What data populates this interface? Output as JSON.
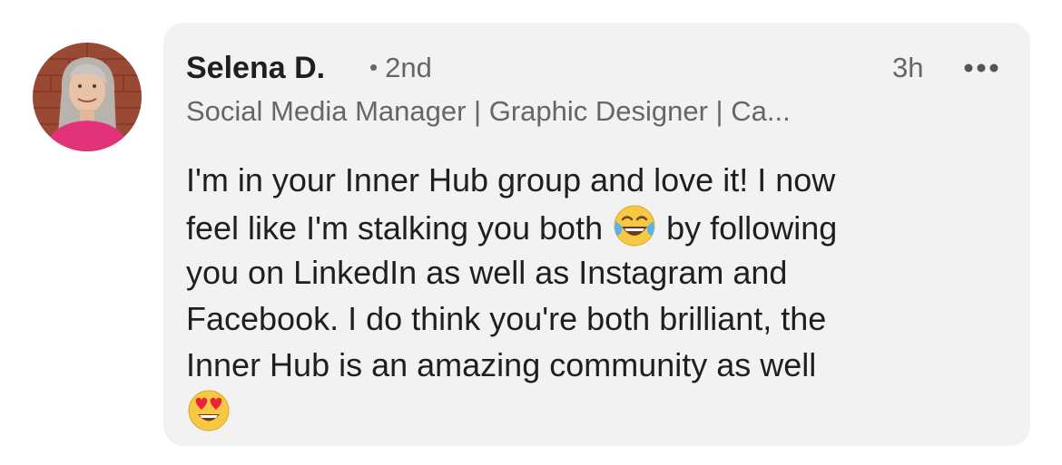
{
  "comment": {
    "author": {
      "name": "Selena D.",
      "degree": "2nd",
      "headline": "Social Media Manager | Graphic Designer | Ca..."
    },
    "time": "3h",
    "more_icon": "more-horizontal-icon",
    "message": {
      "line1": "I'm in your Inner Hub group and love it! I now",
      "line2_before": "feel like I'm stalking you both",
      "line2_emoji": "joy-emoji",
      "line2_after": "by following",
      "line3": "you on LinkedIn as well as Instagram and",
      "line4": "Facebook. I do think you're both brilliant, the",
      "line5": "Inner Hub is an amazing community as well",
      "line6_emoji": "heart-eyes-emoji"
    }
  },
  "colors": {
    "bubble_bg": "#f2f2f2",
    "text_primary": "#1f1f1f",
    "text_secondary": "#666666"
  }
}
